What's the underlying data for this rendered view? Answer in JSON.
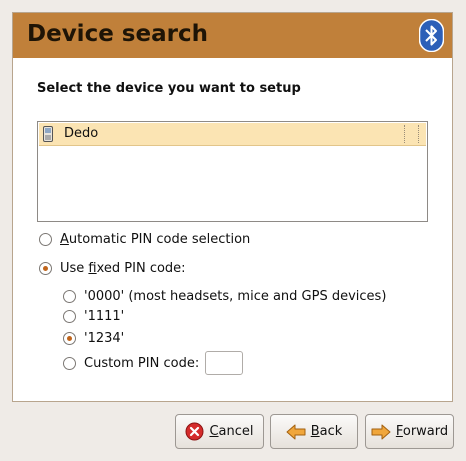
{
  "header": {
    "title": "Device search",
    "accent_color": "#c0803a",
    "icon": "bluetooth-icon"
  },
  "subtitle": "Select the device you want to setup",
  "device_list": {
    "items": [
      {
        "name": "Dedo",
        "icon": "phone-icon",
        "selected": true
      }
    ]
  },
  "pin_mode": {
    "automatic": {
      "label_pre": "",
      "mnemonic": "A",
      "label_post": "utomatic PIN code selection",
      "checked": false
    },
    "fixed": {
      "label_pre": "Use ",
      "mnemonic": "f",
      "label_post": "ixed PIN code:",
      "checked": true
    }
  },
  "fixed_pins": [
    {
      "label": "'0000' (most headsets, mice and GPS devices)",
      "checked": false
    },
    {
      "label": "'1111'",
      "checked": false
    },
    {
      "label": "'1234'",
      "checked": true
    },
    {
      "label": "Custom PIN code:",
      "checked": false,
      "value": ""
    }
  ],
  "buttons": {
    "cancel": {
      "label_pre": "",
      "mnemonic": "C",
      "label_post": "ancel",
      "icon": "cancel-icon"
    },
    "back": {
      "label_pre": "",
      "mnemonic": "B",
      "label_post": "ack",
      "icon": "back-arrow-icon"
    },
    "forward": {
      "label_pre": "",
      "mnemonic": "F",
      "label_post": "orward",
      "icon": "forward-arrow-icon"
    }
  }
}
